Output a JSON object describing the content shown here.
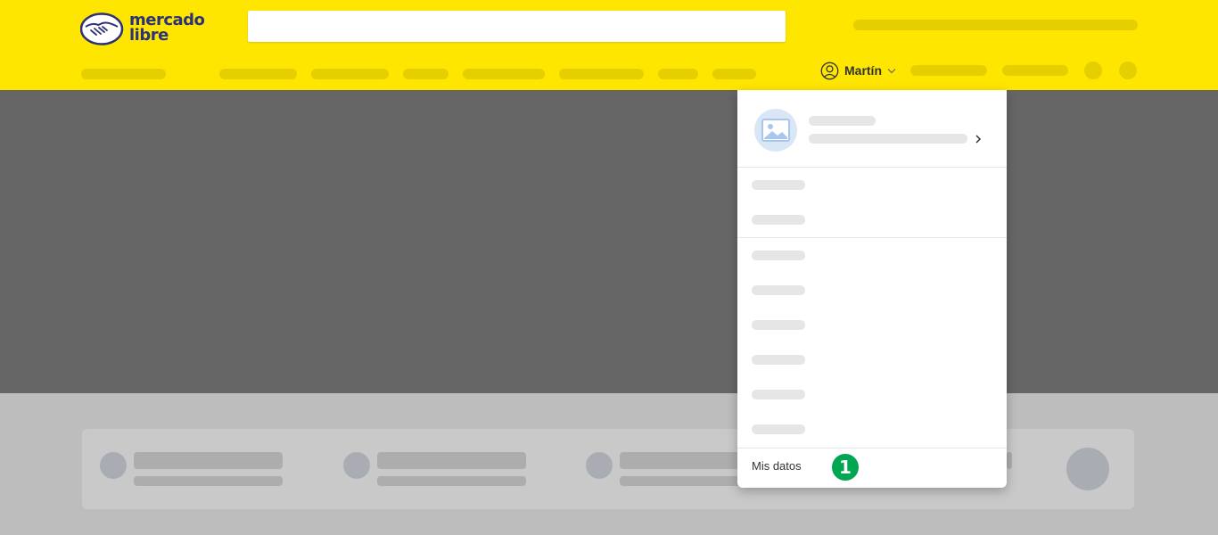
{
  "header": {
    "logo_line1": "mercado",
    "logo_line2": "libre",
    "search_placeholder": "",
    "user_name": "Martín"
  },
  "dropdown": {
    "last_item_label": "Mis datos",
    "step_badge": "1"
  },
  "colors": {
    "header_bg": "#ffe600",
    "brand_navy": "#2d3277",
    "badge_green": "#00a650"
  }
}
